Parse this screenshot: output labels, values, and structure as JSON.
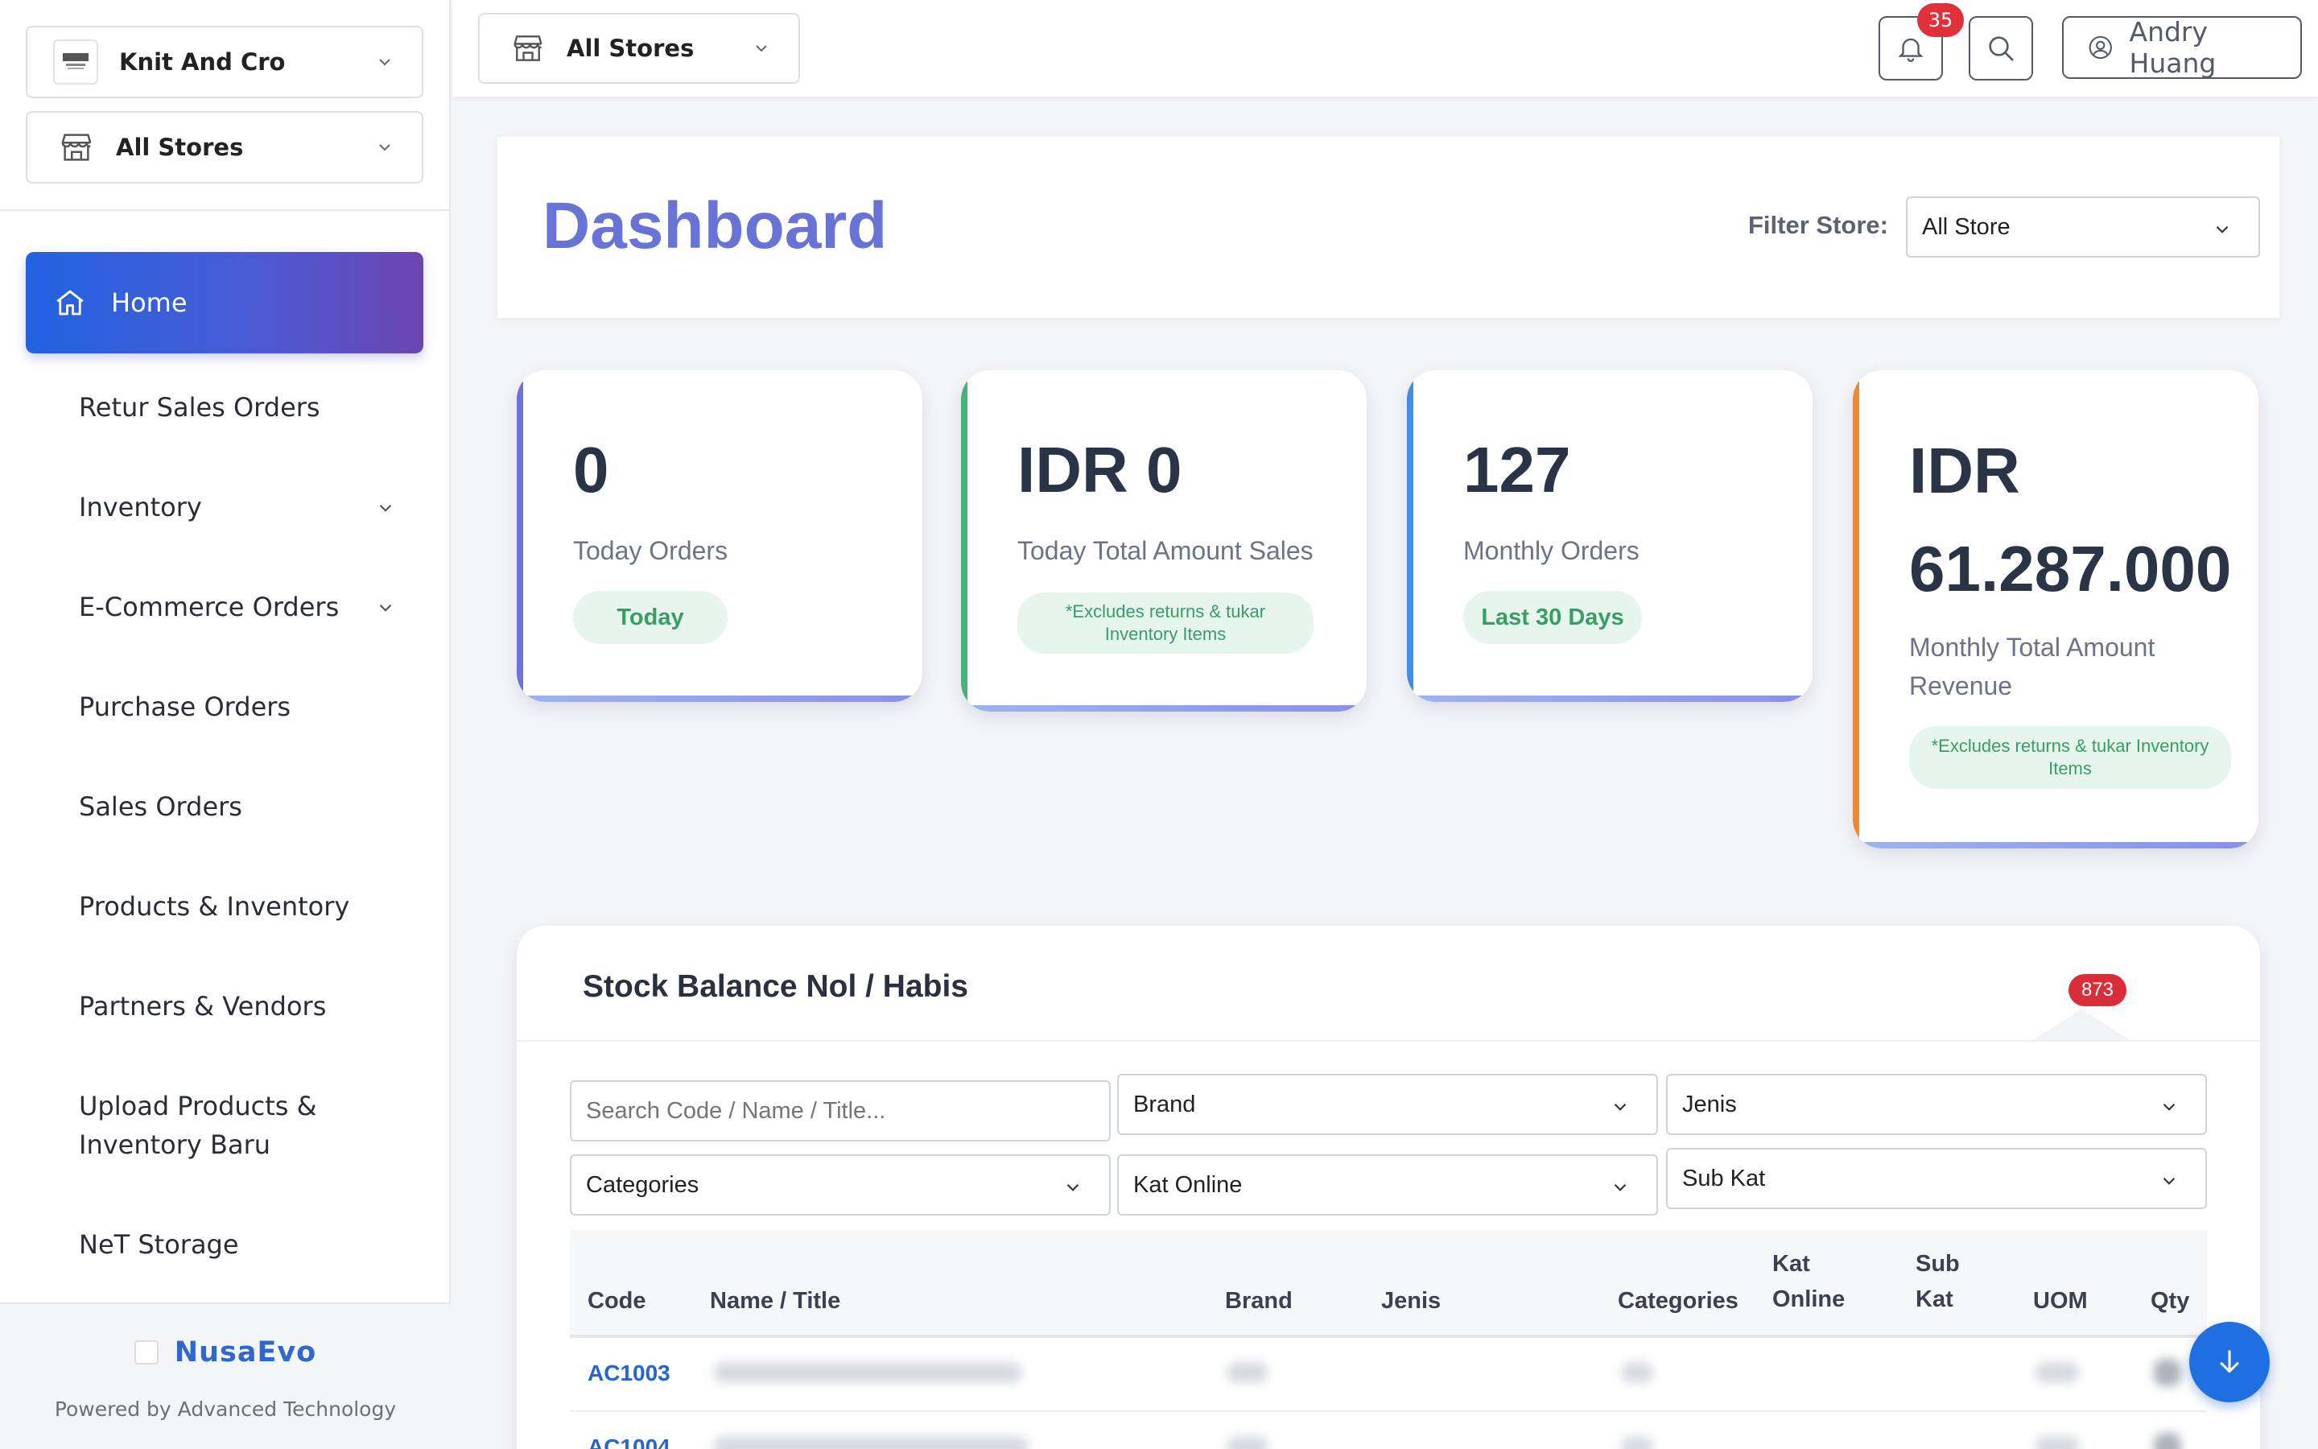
{
  "sidebar": {
    "company": "Knit And Cro",
    "store": "All Stores",
    "nav": {
      "home": "Home",
      "items": [
        "Retur Sales Orders",
        "Inventory",
        "E-Commerce Orders",
        "Purchase Orders",
        "Sales Orders",
        "Products & Inventory",
        "Partners & Vendors",
        "Upload Products & Inventory Baru",
        "NeT Storage"
      ]
    },
    "footer": {
      "brand": "NusaEvo",
      "powered": "Powered by Advanced Technology"
    }
  },
  "topbar": {
    "store": "All Stores",
    "notif_count": "35",
    "user": "Andry Huang"
  },
  "header": {
    "title": "Dashboard",
    "filter_label": "Filter Store:",
    "filter_value": "All Store"
  },
  "stats": [
    {
      "value": "0",
      "label": "Today Orders",
      "pill": "Today",
      "accent": "#6a74d9"
    },
    {
      "value": "IDR 0",
      "label": "Today Total Amount Sales",
      "pill": "*Excludes returns & tukar Inventory Items",
      "accent": "#47b37a"
    },
    {
      "value": "127",
      "label": "Monthly Orders",
      "pill": "Last 30 Days",
      "accent": "#3f8ee8"
    },
    {
      "value": "IDR 61.287.000",
      "label": "Monthly Total Amount Revenue",
      "pill": "*Excludes returns & tukar Inventory Items",
      "accent": "#ec8a35"
    }
  ],
  "stock": {
    "title": "Stock Balance Nol / Habis",
    "count": "873",
    "filters": {
      "search_placeholder": "Search Code / Name / Title...",
      "brand": "Brand",
      "jenis": "Jenis",
      "categories": "Categories",
      "kat_online": "Kat Online",
      "sub_kat": "Sub Kat"
    },
    "columns": {
      "code": "Code",
      "name": "Name / Title",
      "brand": "Brand",
      "jenis": "Jenis",
      "categories": "Categories",
      "kat_online": "Kat Online",
      "sub_kat": "Sub Kat",
      "uom": "UOM",
      "qty": "Qty"
    },
    "rows": [
      {
        "code": "AC1003"
      },
      {
        "code": "AC1004"
      }
    ]
  },
  "colors": {
    "primary": "#2163e0",
    "title": "#6873d6",
    "badge": "#e0313b",
    "link": "#2465d0"
  }
}
